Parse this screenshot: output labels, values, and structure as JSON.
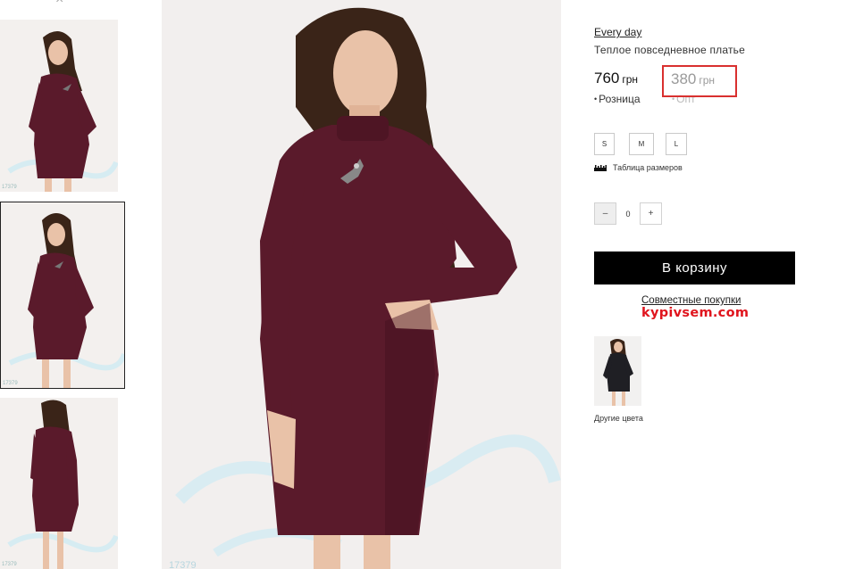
{
  "gallery": {
    "thumbnails": [
      {
        "code": "17379",
        "active": false
      },
      {
        "code": "17379",
        "active": true
      },
      {
        "code": "17379",
        "active": false
      }
    ],
    "main_code": "17379"
  },
  "product": {
    "brand": "Every day",
    "title": "Теплое повседневное платье",
    "price_retail": {
      "amount": "760",
      "currency": "грн",
      "label": "Розница"
    },
    "price_wholesale": {
      "amount": "380",
      "currency": "грн",
      "label": "Опт"
    },
    "sizes": [
      "S",
      "M",
      "L"
    ],
    "size_table_label": "Таблица размеров",
    "quantity": {
      "minus": "–",
      "value": "0",
      "plus": "+"
    },
    "cart_button": "В корзину",
    "joint_purchase_link": "Совместные покупки",
    "watermark_site": "kypivsem.com",
    "other_colors_label": "Другие цвета"
  },
  "colors": {
    "dress": "#5a1a2b",
    "dress_shadow": "#43101f",
    "skin": "#e9c2a8",
    "hair": "#3a2418",
    "highlight_box": "#d9302f",
    "watermark": "#e0141d",
    "cart_bg": "#000000"
  },
  "icons": {
    "ruler": "ruler-icon",
    "close": "close-icon"
  }
}
